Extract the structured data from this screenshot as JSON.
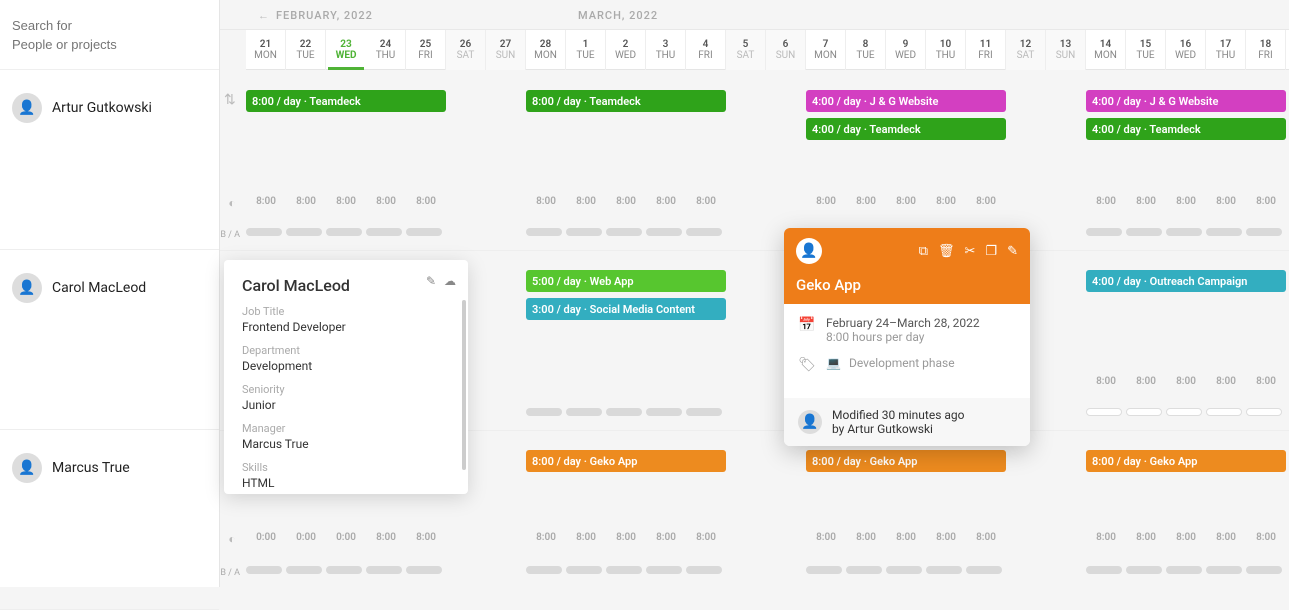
{
  "search": {
    "placeholder_line1": "Search for",
    "placeholder_line2": "People or projects"
  },
  "months": {
    "feb": "FEBRUARY, 2022",
    "mar": "MARCH, 2022"
  },
  "days": [
    {
      "num": "21",
      "dow": "MON",
      "weekend": false,
      "today": false
    },
    {
      "num": "22",
      "dow": "TUE",
      "weekend": false,
      "today": false
    },
    {
      "num": "23",
      "dow": "WED",
      "weekend": false,
      "today": true
    },
    {
      "num": "24",
      "dow": "THU",
      "weekend": false,
      "today": false
    },
    {
      "num": "25",
      "dow": "FRI",
      "weekend": false,
      "today": false
    },
    {
      "num": "26",
      "dow": "SAT",
      "weekend": true,
      "today": false
    },
    {
      "num": "27",
      "dow": "SUN",
      "weekend": true,
      "today": false
    },
    {
      "num": "28",
      "dow": "MON",
      "weekend": false,
      "today": false
    },
    {
      "num": "1",
      "dow": "TUE",
      "weekend": false,
      "today": false
    },
    {
      "num": "2",
      "dow": "WED",
      "weekend": false,
      "today": false
    },
    {
      "num": "3",
      "dow": "THU",
      "weekend": false,
      "today": false
    },
    {
      "num": "4",
      "dow": "FRI",
      "weekend": false,
      "today": false
    },
    {
      "num": "5",
      "dow": "SAT",
      "weekend": true,
      "today": false
    },
    {
      "num": "6",
      "dow": "SUN",
      "weekend": true,
      "today": false
    },
    {
      "num": "7",
      "dow": "MON",
      "weekend": false,
      "today": false
    },
    {
      "num": "8",
      "dow": "TUE",
      "weekend": false,
      "today": false
    },
    {
      "num": "9",
      "dow": "WED",
      "weekend": false,
      "today": false
    },
    {
      "num": "10",
      "dow": "THU",
      "weekend": false,
      "today": false
    },
    {
      "num": "11",
      "dow": "FRI",
      "weekend": false,
      "today": false
    },
    {
      "num": "12",
      "dow": "SAT",
      "weekend": true,
      "today": false
    },
    {
      "num": "13",
      "dow": "SUN",
      "weekend": true,
      "today": false
    },
    {
      "num": "14",
      "dow": "MON",
      "weekend": false,
      "today": false
    },
    {
      "num": "15",
      "dow": "TUE",
      "weekend": false,
      "today": false
    },
    {
      "num": "16",
      "dow": "WED",
      "weekend": false,
      "today": false
    },
    {
      "num": "17",
      "dow": "THU",
      "weekend": false,
      "today": false
    },
    {
      "num": "18",
      "dow": "FRI",
      "weekend": false,
      "today": false
    }
  ],
  "resources": [
    {
      "name": "Artur Gutkowski"
    },
    {
      "name": "Carol MacLeod"
    },
    {
      "name": "Marcus True"
    }
  ],
  "bars": {
    "r0": {
      "teamdeck1": "8:00 / day · Teamdeck",
      "teamdeck2": "8:00 / day · Teamdeck",
      "jg1": "4:00 / day · J & G Website",
      "teamdeck3": "4:00 / day · Teamdeck",
      "jg2": "4:00 / day · J & G Website",
      "teamdeck4": "4:00 / day · Teamdeck"
    },
    "r1": {
      "webapp": "5:00 / day · Web App",
      "social": "3:00 / day · Social Media Content",
      "outreach": "4:00 / day · Outreach Campaign"
    },
    "r2": {
      "geko1": "8:00 / day · Geko App",
      "geko2": "8:00 / day · Geko App",
      "geko3": "8:00 / day · Geko App"
    }
  },
  "hours_row_r0": [
    "8:00",
    "8:00",
    "8:00",
    "8:00",
    "8:00",
    "",
    "",
    "8:00",
    "8:00",
    "8:00",
    "8:00",
    "8:00",
    "",
    "",
    "8:00",
    "8:00",
    "8:00",
    "8:00",
    "8:00",
    "",
    "",
    "8:00",
    "8:00",
    "8:00",
    "8:00",
    "8:00"
  ],
  "hours_row_r2a": [
    "",
    "",
    "",
    "",
    "",
    "",
    "",
    "",
    "",
    "",
    "",
    "",
    "",
    "",
    "",
    "",
    "",
    "",
    "",
    "",
    "",
    "8:00",
    "8:00",
    "8:00",
    "8:00",
    "8:00"
  ],
  "hours_row_r2b": [
    "0:00",
    "0:00",
    "0:00",
    "8:00",
    "8:00",
    "",
    "",
    "8:00",
    "8:00",
    "8:00",
    "8:00",
    "8:00",
    "",
    "",
    "8:00",
    "8:00",
    "8:00",
    "8:00",
    "8:00",
    "",
    "",
    "8:00",
    "8:00",
    "8:00",
    "8:00",
    "8:00"
  ],
  "ba_label": "B / A",
  "moon_icon": "◐",
  "reorder_icon": "⇅",
  "person_popover": {
    "name": "Carol MacLeod",
    "job_label": "Job Title",
    "job": "Frontend Developer",
    "dept_label": "Department",
    "dept": "Development",
    "seniority_label": "Seniority",
    "seniority": "Junior",
    "manager_label": "Manager",
    "manager": "Marcus True",
    "skills_label": "Skills",
    "skills": "HTML"
  },
  "task_popover": {
    "title": "Geko App",
    "dates": "February 24–March 28, 2022",
    "hours": "8:00 hours per day",
    "phase": "Development phase",
    "modified": "Modified 30 minutes ago",
    "by": "by Artur Gutkowski"
  }
}
